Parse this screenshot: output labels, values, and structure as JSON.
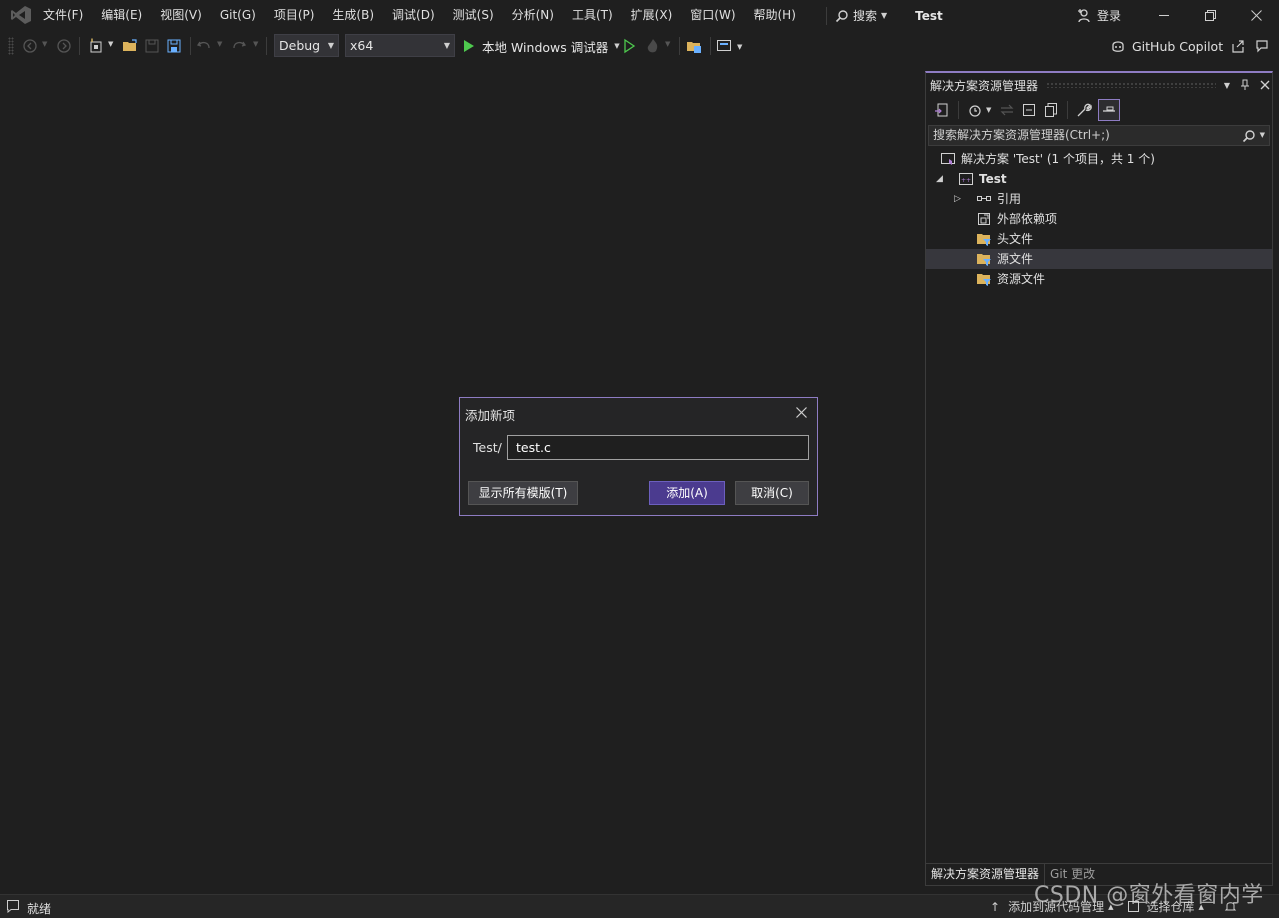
{
  "menubar": {
    "items": [
      "文件(F)",
      "编辑(E)",
      "视图(V)",
      "Git(G)",
      "项目(P)",
      "生成(B)",
      "调试(D)",
      "测试(S)",
      "分析(N)",
      "工具(T)",
      "扩展(X)",
      "窗口(W)",
      "帮助(H)"
    ],
    "search_label": "搜索",
    "solution_title": "Test",
    "login_label": "登录"
  },
  "toolbar": {
    "config": "Debug",
    "platform": "x64",
    "run_label": "本地 Windows 调试器",
    "copilot_label": "GitHub Copilot"
  },
  "solution_explorer": {
    "title": "解决方案资源管理器",
    "search_placeholder": "搜索解决方案资源管理器(Ctrl+;)",
    "solution_row": "解决方案 'Test' (1 个项目，共 1 个)",
    "project_row": "Test",
    "nodes": [
      "引用",
      "外部依赖项",
      "头文件",
      "源文件",
      "资源文件"
    ],
    "tabs": [
      "解决方案资源管理器",
      "Git 更改"
    ]
  },
  "dialog": {
    "title": "添加新项",
    "path_prefix": "Test/",
    "filename": "test.c",
    "show_templates": "显示所有模版(T)",
    "add": "添加(A)",
    "cancel": "取消(C)"
  },
  "statusbar": {
    "status": "就绪",
    "source_control": "添加到源代码管理",
    "repo": "选择仓库"
  },
  "watermark": "CSDN @窗外看窗内学",
  "colors": {
    "background": "#1f1f1f",
    "accent": "#8e7cc3",
    "primary_button": "#4b3b8f",
    "run_green": "#4ec94e"
  }
}
